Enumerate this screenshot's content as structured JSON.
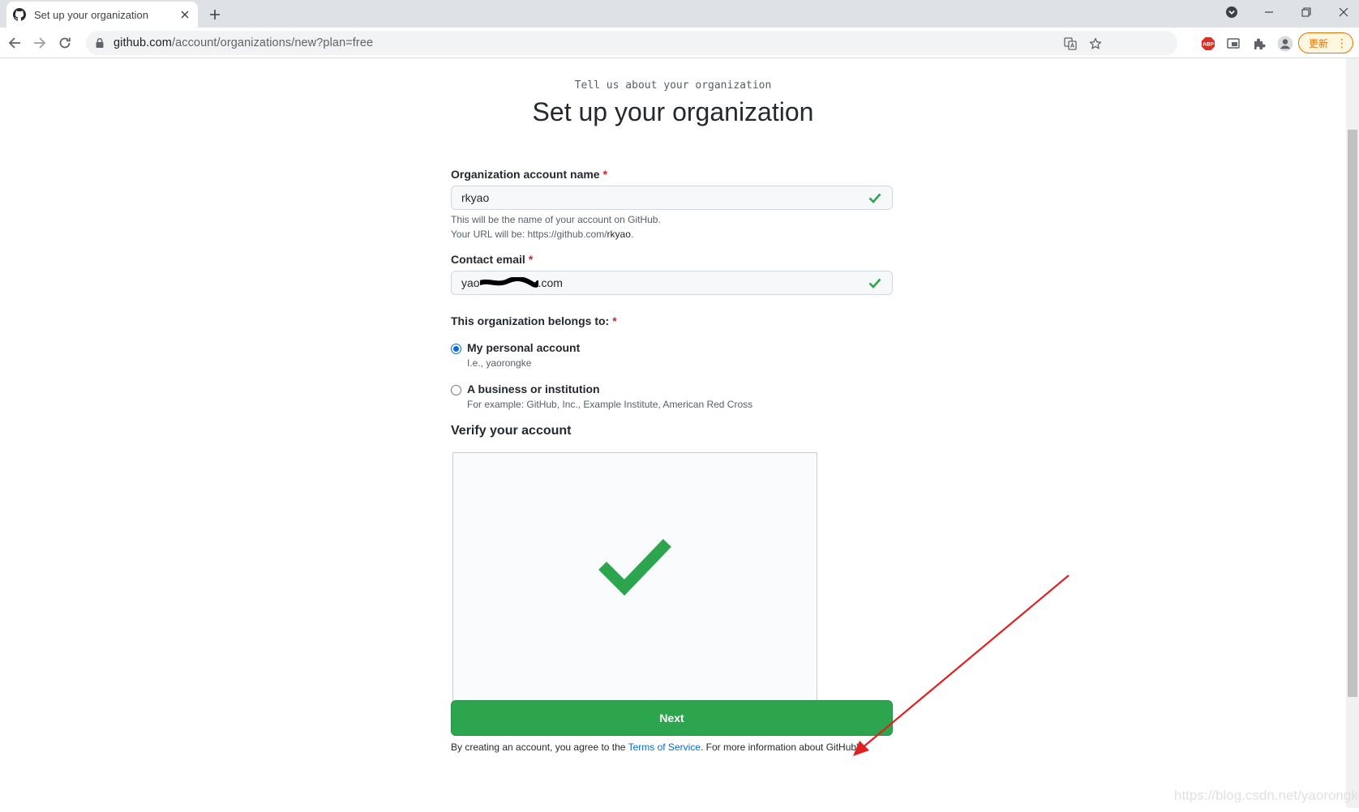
{
  "browser": {
    "tab_title": "Set up your organization",
    "new_tab_symbol": "+",
    "url_host": "github.com",
    "url_path": "/account/organizations/new?plan=free",
    "update_label": "更新",
    "menu_symbol": "⋮",
    "icons": {
      "favicon": "github-octocat-icon",
      "back": "arrow-left-icon",
      "forward": "arrow-right-icon",
      "reload": "reload-icon",
      "lock": "lock-icon",
      "translate": "translate-icon",
      "bookmark": "star-icon",
      "adblock": "adblock-icon",
      "cast": "cast-icon",
      "extensions": "puzzle-icon",
      "profile": "profile-icon"
    }
  },
  "page": {
    "kicker": "Tell us about your organization",
    "title": "Set up your organization"
  },
  "form": {
    "org_name": {
      "label": "Organization account name",
      "required_mark": "*",
      "value": "rkyao",
      "help_line1": "This will be the name of your account on GitHub.",
      "help_line2_prefix": "Your URL will be: https://github.com/",
      "help_line2_name": "rkyao",
      "help_line2_suffix": "."
    },
    "email": {
      "label": "Contact email",
      "required_mark": "*",
      "value_prefix": "yao",
      "value_suffix": ".com"
    },
    "belongs_to": {
      "label": "This organization belongs to:",
      "required_mark": "*",
      "options": [
        {
          "title": "My personal account",
          "subtitle": "I.e., yaorongke",
          "selected": true
        },
        {
          "title": "A business or institution",
          "subtitle": "For example: GitHub, Inc., Example Institute, American Red Cross",
          "selected": false
        }
      ]
    },
    "verify": {
      "title": "Verify your account",
      "status_icon": "checkmark-icon"
    },
    "next_label": "Next",
    "terms_prefix": "By creating an account, you agree to the ",
    "terms_link": "Terms of Service",
    "terms_suffix": ". For more information about GitHub's"
  },
  "annotation": {
    "arrow_color": "#e02020"
  },
  "watermark": "https://blog.csdn.net/yaorongke",
  "colors": {
    "accent_green": "#2da44e",
    "check_green": "#2da44e",
    "link_blue": "#0969da",
    "required_red": "#cf222e"
  }
}
